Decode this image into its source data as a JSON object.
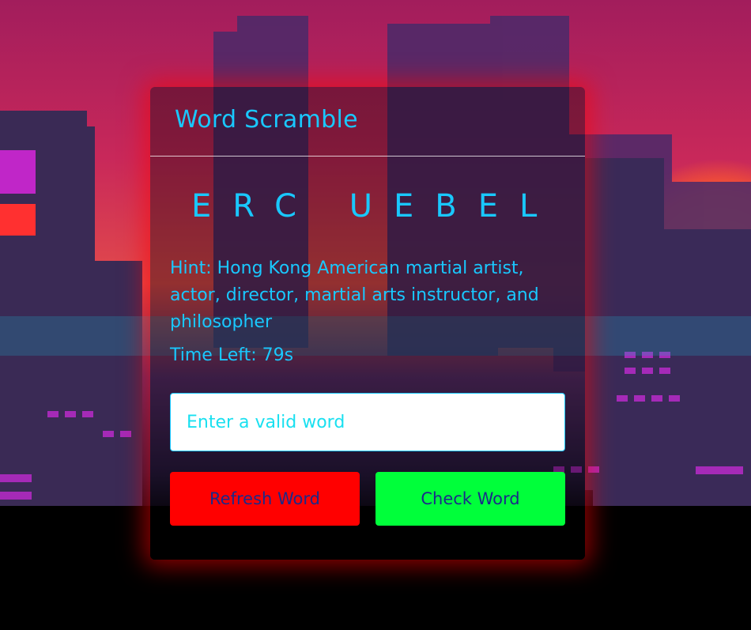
{
  "app": {
    "title": "Word Scramble"
  },
  "game": {
    "scrambled_word": "ERC UEBEL",
    "hint": "Hint: Hong Kong American martial artist, actor, director, martial arts instructor, and philosopher",
    "time_left": "Time Left: 79s"
  },
  "input": {
    "value": "",
    "placeholder": "Enter a valid word"
  },
  "buttons": {
    "refresh_label": "Refresh Word",
    "check_label": "Check Word"
  },
  "colors": {
    "accent_text": "#19c8ff",
    "refresh_button": "#ff0000",
    "check_button": "#00ff3a",
    "button_text": "#1a2a8a",
    "card_glow": "#ff0000"
  },
  "icons": {
    "background": "pixel-city-skyline"
  }
}
